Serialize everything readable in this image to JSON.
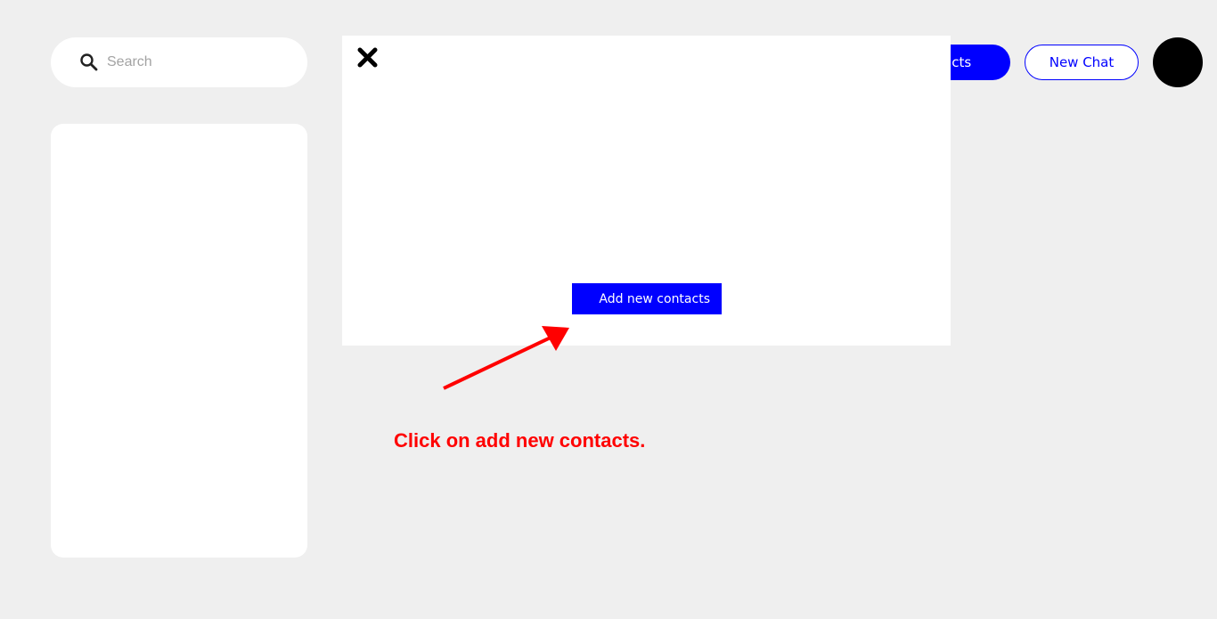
{
  "search": {
    "placeholder": "Search",
    "icon": "search-icon"
  },
  "header": {
    "contacts_button_label": "Contacts",
    "contacts_button_visible_label": "tacts",
    "new_chat_button_label": "New Chat"
  },
  "modal": {
    "close_icon": "close-icon",
    "add_contacts_label": "Add new contacts"
  },
  "annotation": {
    "instruction": "Click on add new contacts.",
    "color": "#ff0000"
  },
  "colors": {
    "accent": "#0000ff",
    "background": "#efefef",
    "panel": "#ffffff"
  }
}
